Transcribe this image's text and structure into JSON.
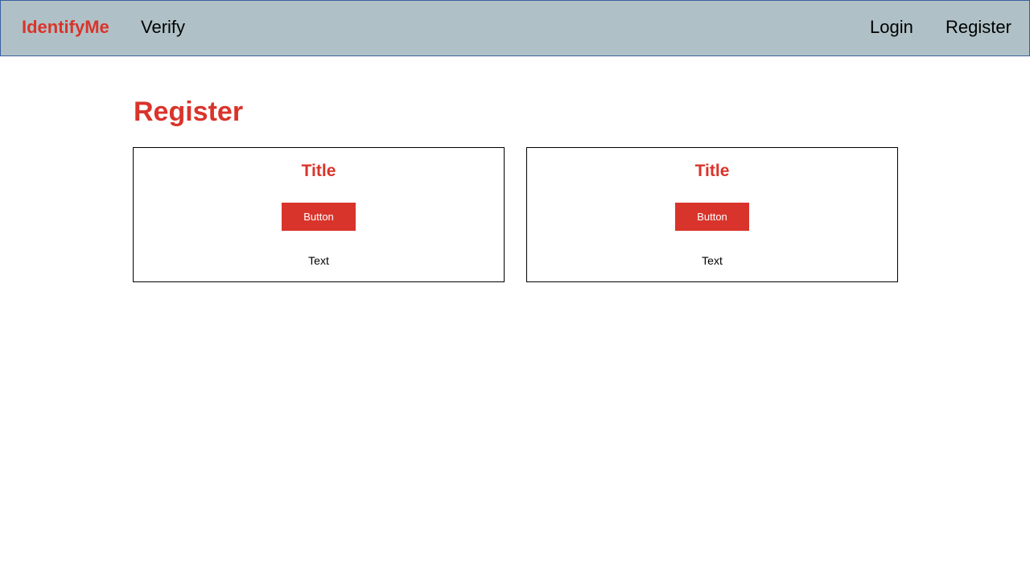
{
  "navbar": {
    "brand": "IdentifyMe",
    "links": {
      "verify": "Verify",
      "login": "Login",
      "register": "Register"
    }
  },
  "page": {
    "title": "Register"
  },
  "cards": [
    {
      "title": "Title",
      "button_label": "Button",
      "text": "Text"
    },
    {
      "title": "Title",
      "button_label": "Button",
      "text": "Text"
    }
  ],
  "colors": {
    "accent": "#d9342b",
    "navbar_bg": "#afc1c6",
    "navbar_border": "#3b5fa0"
  }
}
